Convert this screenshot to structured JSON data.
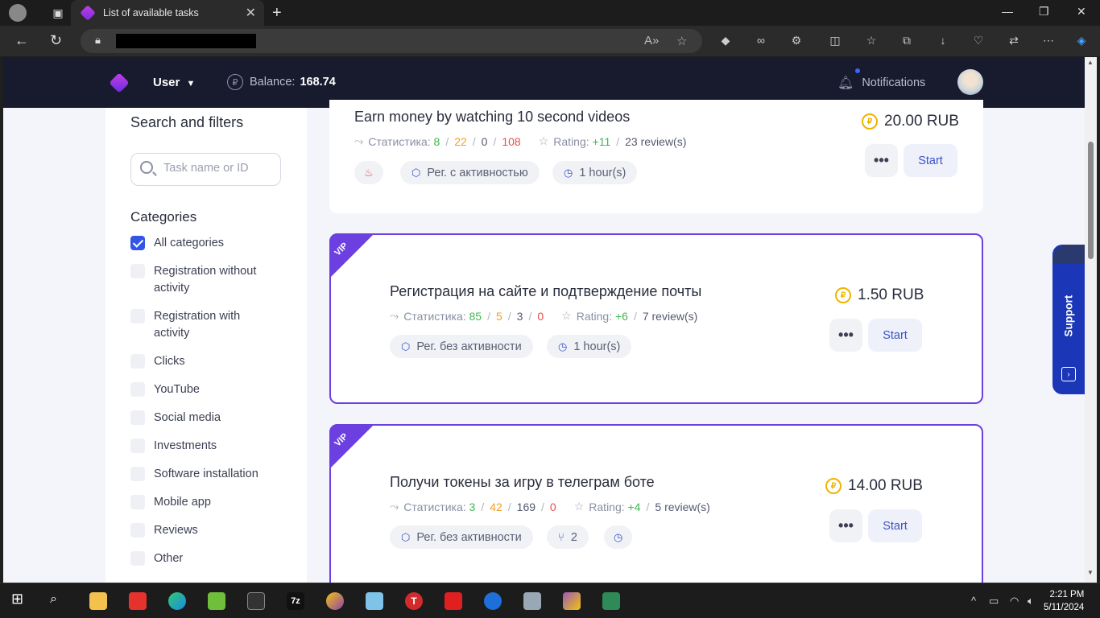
{
  "browser": {
    "tab_title": "List of available tasks"
  },
  "header": {
    "user_label": "User",
    "balance_label": "Balance:",
    "balance_value": "168.74",
    "notifications_label": "Notifications"
  },
  "sidebar": {
    "title": "Search and filters",
    "search_placeholder": "Task name or ID",
    "categories_title": "Categories",
    "categories": [
      {
        "label": "All categories",
        "checked": true
      },
      {
        "label": "Registration without activity",
        "checked": false
      },
      {
        "label": "Registration with activity",
        "checked": false
      },
      {
        "label": "Clicks",
        "checked": false
      },
      {
        "label": "YouTube",
        "checked": false
      },
      {
        "label": "Social media",
        "checked": false
      },
      {
        "label": "Investments",
        "checked": false
      },
      {
        "label": "Software installation",
        "checked": false
      },
      {
        "label": "Mobile app",
        "checked": false
      },
      {
        "label": "Reviews",
        "checked": false
      },
      {
        "label": "Other",
        "checked": false
      }
    ]
  },
  "tasks": [
    {
      "title": "Earn money by watching 10 second videos",
      "stats_label": "Статистика:",
      "stats": [
        "8",
        "22",
        "0",
        "108"
      ],
      "rating_label": "Rating:",
      "rating": "+11",
      "reviews": "23 review(s)",
      "chips": [
        "Рег. с активностью",
        "1 hour(s)"
      ],
      "price": "20.00 RUB",
      "vip": false,
      "start_label": "Start"
    },
    {
      "title": "Регистрация на сайте и подтверждение почты",
      "stats_label": "Статистика:",
      "stats": [
        "85",
        "5",
        "3",
        "0"
      ],
      "rating_label": "Rating:",
      "rating": "+6",
      "reviews": "7 review(s)",
      "chips": [
        "Рег. без активности",
        "1 hour(s)"
      ],
      "price": "1.50 RUB",
      "vip": true,
      "vip_label": "VIP",
      "start_label": "Start"
    },
    {
      "title": "Получи токены за игру в телеграм боте",
      "stats_label": "Статистика:",
      "stats": [
        "3",
        "42",
        "169",
        "0"
      ],
      "rating_label": "Rating:",
      "rating": "+4",
      "reviews": "5 review(s)",
      "chips": [
        "Рег. без активности",
        "2"
      ],
      "price": "14.00 RUB",
      "vip": true,
      "vip_label": "VIP",
      "start_label": "Start"
    }
  ],
  "support_label": "Support",
  "taskbar": {
    "time": "2:21 PM",
    "date": "5/11/2024"
  },
  "colors": {
    "header_bg": "#181b2e",
    "accent_blue": "#3d54c8",
    "vip_purple": "#6b3fe0",
    "coin_gold": "#f0b400"
  }
}
